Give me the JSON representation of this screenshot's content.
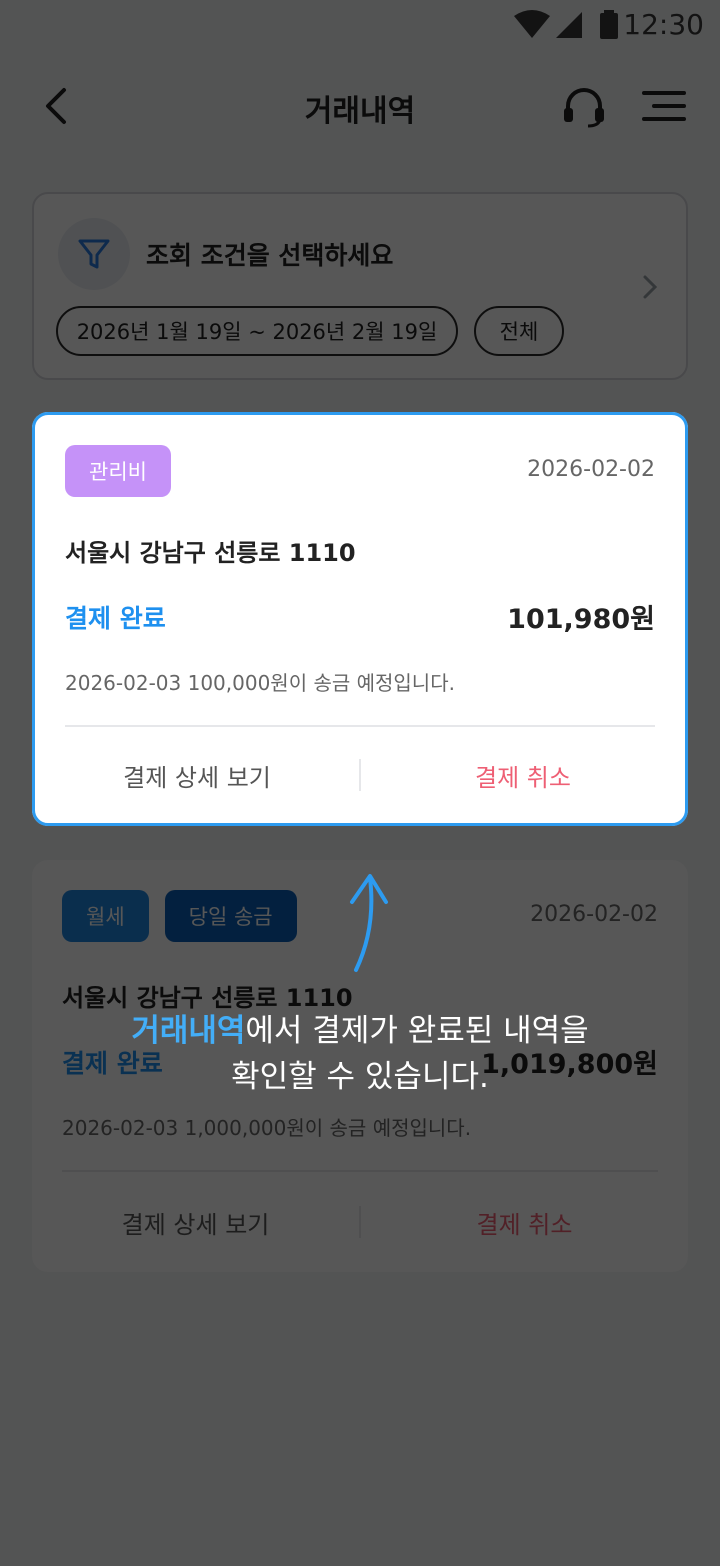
{
  "status_bar": {
    "time": "12:30"
  },
  "header": {
    "title": "거래내역",
    "back_icon": "chevron-left-icon",
    "support_icon": "headset-icon",
    "menu_icon": "menu-icon"
  },
  "filter": {
    "title": "조회 조건을 선택하세요",
    "period": "2026년 1월 19일 ~ 2026년 2월 19일",
    "type": "전체",
    "icon": "funnel-icon"
  },
  "transactions": [
    {
      "badges": [
        "관리비"
      ],
      "date": "2026-02-02",
      "address": "서울시 강남구 선릉로 1110",
      "status": "결제 완료",
      "amount": "101,980원",
      "note": "2026-02-03 100,000원이 송금 예정입니다.",
      "detail_label": "결제 상세 보기",
      "cancel_label": "결제 취소"
    },
    {
      "badges": [
        "월세",
        "당일 송금"
      ],
      "date": "2026-02-02",
      "address": "서울시 강남구 선릉로 1110",
      "status": "결제 완료",
      "amount": "1,019,800원",
      "note": "2026-02-03 1,000,000원이 송금 예정입니다.",
      "detail_label": "결제 상세 보기",
      "cancel_label": "결제 취소"
    }
  ],
  "guide": {
    "highlight": "거래내역",
    "line1_rest": "에서 결제가 완료된 내역을",
    "line2": "확인할 수 있습니다."
  },
  "colors": {
    "accent": "#1e90ef",
    "cancel": "#ee5f74",
    "badge_purple": "#c592f8",
    "badge_blue": "#1f87e0",
    "badge_navy": "#0a5fb8"
  }
}
